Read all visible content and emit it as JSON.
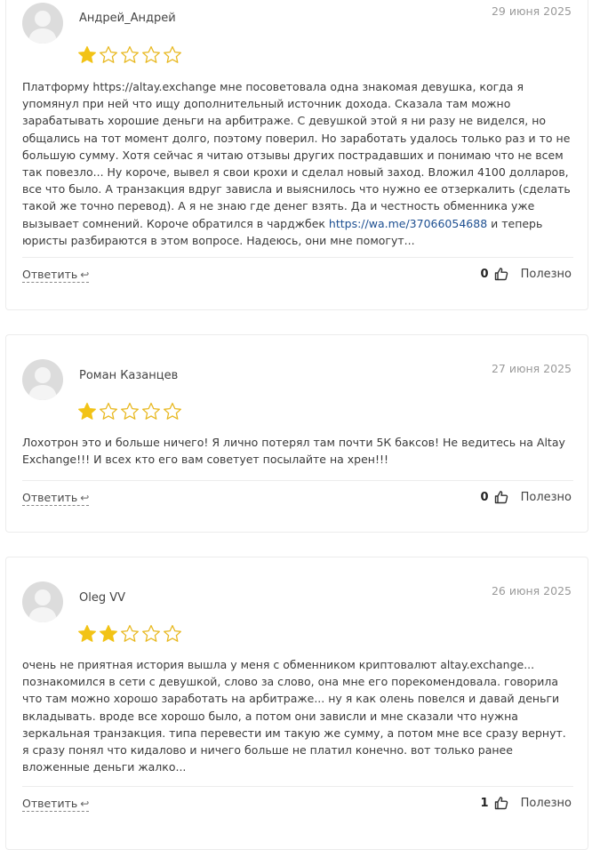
{
  "reviews": [
    {
      "author": "Андрей_Андрей",
      "date": "29 июня 2025",
      "rating": 1,
      "max_rating": 5,
      "text_before_link": "Платформу https://altay.exchange мне посоветовала одна знакомая девушка, когда я упомянул при ней что ищу дополнительный источник дохода. Сказала там можно зарабатывать хорошие деньги на арбитраже. С девушкой этой я ни разу не виделся, но общались на тот момент долго, поэтому поверил. Но заработать удалось только раз и то не большую сумму. Хотя сейчас я читаю отзывы других пострадавших и понимаю что не всем так повезло... Ну короче, вывел я свои крохи и сделал новый заход. Вложил 4100 долларов, все что было. А транзакция вдруг зависла и выяснилось что нужно ее отзеркалить (сделать такой же точно перевод). А я не знаю где денег взять. Да и честность обменника уже вызывает сомнений. Короче обратился в чарджбек ",
      "link": "https://wa.me/37066054688",
      "text_after_link": " и теперь юристы разбираются в этом вопросе. Надеюсь, они мне помогут...",
      "reply_label": "Ответить",
      "helpful_count": "0",
      "helpful_label": "Полезно"
    },
    {
      "author": "Роман Казанцев",
      "date": "27 июня 2025",
      "rating": 1,
      "max_rating": 5,
      "text": "Лохотрон это и больше ничего! Я лично потерял там почти 5К баксов! Не ведитесь на Altay Exchange!!! И всех кто его вам советует посылайте на хрен!!!",
      "reply_label": "Ответить",
      "helpful_count": "0",
      "helpful_label": "Полезно"
    },
    {
      "author": "Oleg VV",
      "date": "26 июня 2025",
      "rating": 2,
      "max_rating": 5,
      "text": "очень не приятная история вышла у меня с обменником криптовалют altay.exchange... познакомился в сети с девушкой, слово за слово, она мне его порекомендовала. говорила что там можно хорошо заработать на арбитраже... ну я как олень повелся и давай деньги вкладывать. вроде все хорошо было, а потом они зависли и мне сказали что нужна зеркальная транзакция. типа перевести им такую же сумму, а потом мне все сразу вернут. я сразу понял что кидалово и ничего больше не платил конечно. вот только ранее вложенные деньги жалко...",
      "reply_label": "Ответить",
      "helpful_count": "1",
      "helpful_label": "Полезно"
    }
  ],
  "colors": {
    "star_filled": "#f2c316",
    "star_empty": "#e8b820",
    "link": "#1d4f91",
    "avatar_bg": "#dcdcdc"
  }
}
